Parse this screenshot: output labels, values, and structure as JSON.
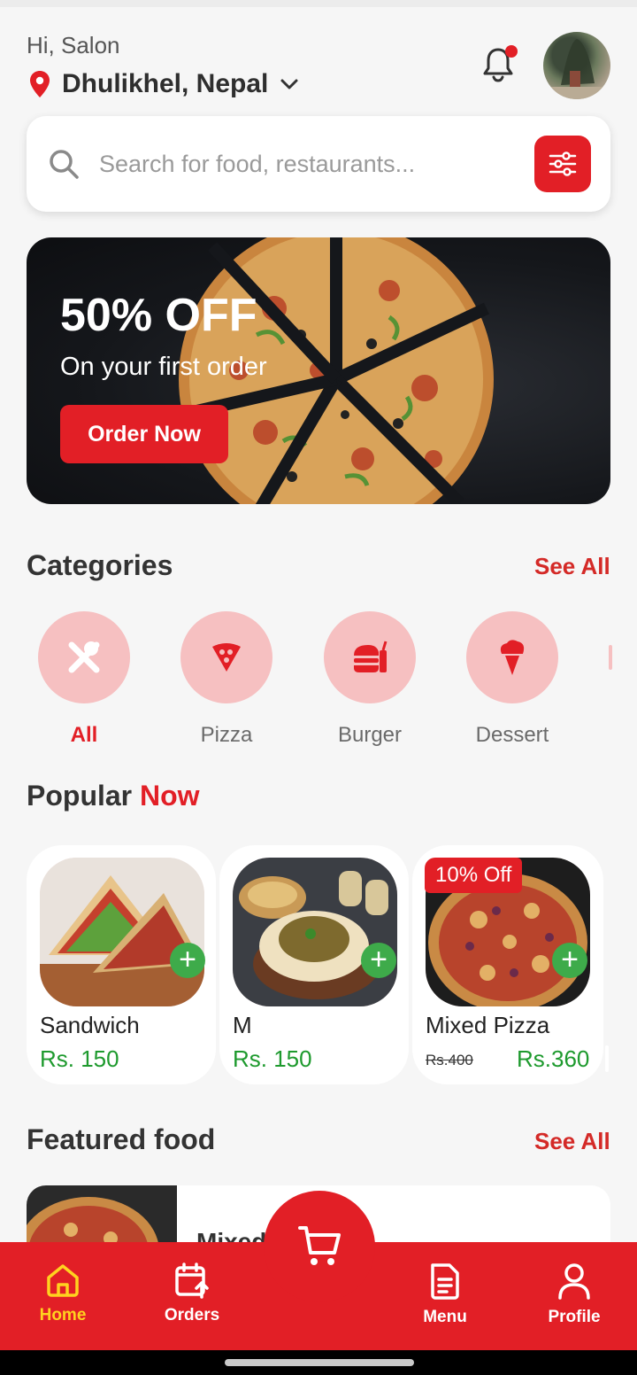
{
  "header": {
    "greeting": "Hi, Salon",
    "location": "Dhulikhel, Nepal"
  },
  "search": {
    "placeholder": "Search for food, restaurants..."
  },
  "banner": {
    "title": "50% OFF",
    "subtitle": "On your first order",
    "button": "Order Now"
  },
  "categories": {
    "title": "Categories",
    "see_all": "See All",
    "items": [
      {
        "label": "All",
        "icon": "utensils-icon",
        "active": true
      },
      {
        "label": "Pizza",
        "icon": "pizza-icon",
        "active": false
      },
      {
        "label": "Burger",
        "icon": "burger-icon",
        "active": false
      },
      {
        "label": "Dessert",
        "icon": "ice-cream-icon",
        "active": false
      }
    ]
  },
  "popular": {
    "title_part1": "Popular",
    "title_part2": "Now",
    "items": [
      {
        "name": "Sandwich",
        "price": "Rs. 150"
      },
      {
        "name": "M",
        "price": "Rs. 150"
      },
      {
        "name": "Mixed Pizza",
        "old_price": "Rs.400",
        "price": "Rs.360",
        "badge": "10% Off"
      }
    ]
  },
  "featured": {
    "title": "Featured food",
    "see_all": "See All",
    "first_item_partial": "Mixed"
  },
  "nav": {
    "items": [
      {
        "label": "Home",
        "icon": "home-icon",
        "active": true
      },
      {
        "label": "Orders",
        "icon": "calendar-upload-icon",
        "active": false
      },
      {
        "label": "Menu",
        "icon": "document-icon",
        "active": false
      },
      {
        "label": "Profile",
        "icon": "user-icon",
        "active": false
      }
    ],
    "cart_icon": "cart-icon"
  },
  "colors": {
    "primary": "#e21f26",
    "price_green": "#1e9a2e",
    "category_bg": "#f6c0c1",
    "nav_active": "#ffd21f"
  }
}
